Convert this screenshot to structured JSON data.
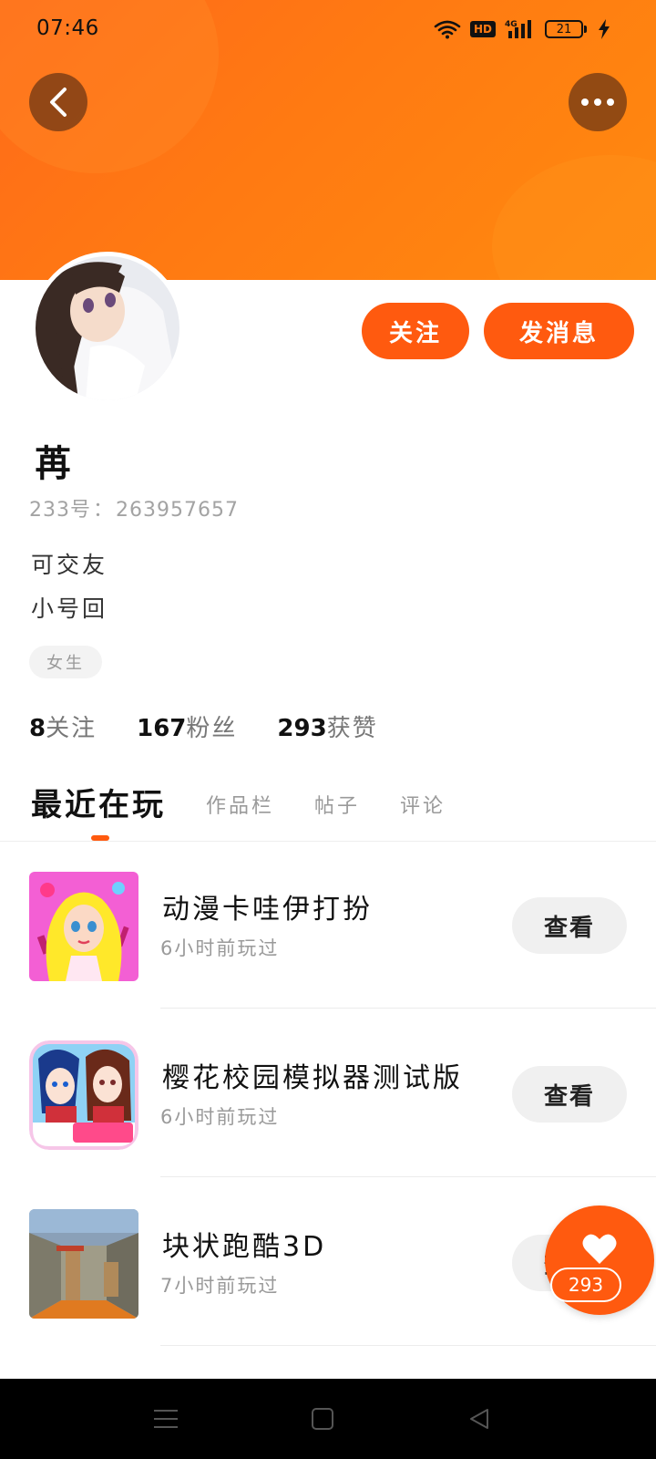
{
  "status_bar": {
    "time": "07:46",
    "network": "4G",
    "battery": "21"
  },
  "profile": {
    "follow_label": "关注",
    "message_label": "发消息",
    "username": "苒",
    "id_label": "233号",
    "id_sep": "：",
    "id_value": "263957657",
    "bio_line1": "可交友",
    "bio_line2": "小号回",
    "gender_tag": "女生"
  },
  "stats": {
    "following_count": "8",
    "following_label": "关注",
    "fans_count": "167",
    "fans_label": "粉丝",
    "likes_count": "293",
    "likes_label": "获赞"
  },
  "tabs": [
    "最近在玩",
    "作品栏",
    "帖子",
    "评论"
  ],
  "games": [
    {
      "title": "动漫卡哇伊打扮",
      "time": "6小时前玩过",
      "button": "查看"
    },
    {
      "title": "樱花校园模拟器测试版",
      "time": "6小时前玩过",
      "button": "查看"
    },
    {
      "title": "块状跑酷3D",
      "time": "7小时前玩过",
      "button": "查看"
    }
  ],
  "like_fab": {
    "count": "293"
  },
  "colors": {
    "accent": "#ff5a0f",
    "banner_start": "#ff6a1a",
    "banner_end": "#ff8a0f",
    "view_button_bg": "#f0f0f0"
  }
}
